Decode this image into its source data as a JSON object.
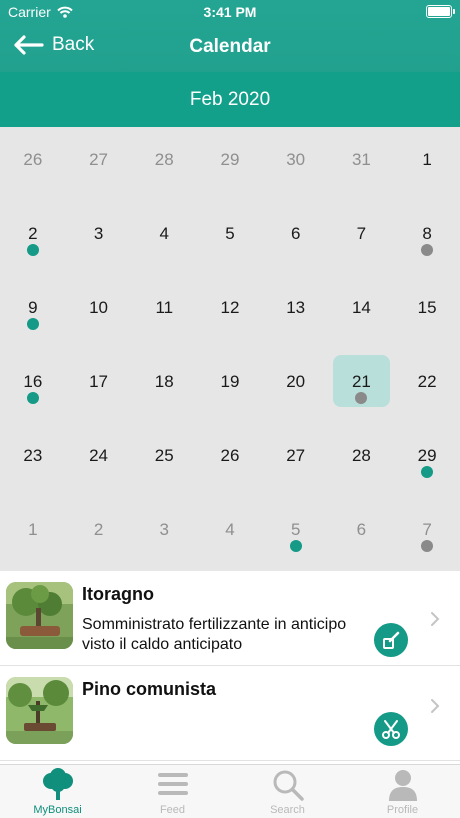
{
  "status_bar": {
    "carrier": "Carrier",
    "time": "3:41 PM"
  },
  "nav": {
    "back_label": "Back",
    "title": "Calendar"
  },
  "calendar": {
    "month_label": "Feb 2020",
    "weeks": [
      [
        {
          "d": "26",
          "muted": true
        },
        {
          "d": "27",
          "muted": true
        },
        {
          "d": "28",
          "muted": true
        },
        {
          "d": "29",
          "muted": true
        },
        {
          "d": "30",
          "muted": true
        },
        {
          "d": "31",
          "muted": true
        },
        {
          "d": "1"
        }
      ],
      [
        {
          "d": "2",
          "event": "more"
        },
        {
          "d": "3"
        },
        {
          "d": "4"
        },
        {
          "d": "5"
        },
        {
          "d": "6"
        },
        {
          "d": "7"
        },
        {
          "d": "8",
          "event": "soil"
        }
      ],
      [
        {
          "d": "9",
          "event": "more"
        },
        {
          "d": "10"
        },
        {
          "d": "11"
        },
        {
          "d": "12"
        },
        {
          "d": "13"
        },
        {
          "d": "14"
        },
        {
          "d": "15"
        }
      ],
      [
        {
          "d": "16",
          "event": "fertilize"
        },
        {
          "d": "17"
        },
        {
          "d": "18"
        },
        {
          "d": "19"
        },
        {
          "d": "20"
        },
        {
          "d": "21",
          "selected": true,
          "event": "soil"
        },
        {
          "d": "22"
        }
      ],
      [
        {
          "d": "23"
        },
        {
          "d": "24"
        },
        {
          "d": "25"
        },
        {
          "d": "26"
        },
        {
          "d": "27"
        },
        {
          "d": "28"
        },
        {
          "d": "29",
          "event": "prune"
        }
      ],
      [
        {
          "d": "1",
          "muted": true
        },
        {
          "d": "2",
          "muted": true
        },
        {
          "d": "3",
          "muted": true
        },
        {
          "d": "4",
          "muted": true
        },
        {
          "d": "5",
          "muted": true,
          "event": "fertilize"
        },
        {
          "d": "6",
          "muted": true
        },
        {
          "d": "7",
          "muted": true,
          "event": "soil"
        }
      ]
    ]
  },
  "entries": [
    {
      "title": "Itoragno",
      "description": "Somministrato fertilizzante in anticipo visto il caldo anticipato",
      "action_icon": "fertilizer-icon"
    },
    {
      "title": "Pino comunista",
      "description": "",
      "action_icon": "scissors-icon"
    }
  ],
  "tabs": [
    {
      "label": "MyBonsai",
      "icon": "tree-icon",
      "active": true
    },
    {
      "label": "Feed",
      "icon": "list-icon",
      "active": false
    },
    {
      "label": "Search",
      "icon": "search-icon",
      "active": false
    },
    {
      "label": "Profile",
      "icon": "person-icon",
      "active": false
    }
  ],
  "colors": {
    "primary": "#1e9d8a",
    "month_bar": "#12a08b",
    "selected_day": "#b9dfdb",
    "accent": "#159a88",
    "inactive": "#b9b9b9"
  }
}
